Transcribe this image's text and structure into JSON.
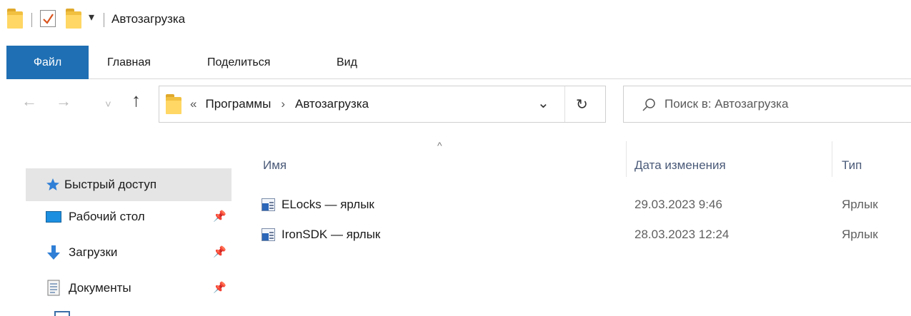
{
  "window": {
    "title": "Автозагрузка"
  },
  "quick_access_toolbar": {
    "dropdown_glyph": "▾"
  },
  "ribbon": {
    "file_tab": "Файл",
    "tabs": [
      "Главная",
      "Поделиться",
      "Вид"
    ]
  },
  "nav": {
    "back_glyph": "←",
    "forward_glyph": "→",
    "recent_glyph": "˅",
    "up_glyph": "↑",
    "breadcrumb_prefix": "«",
    "breadcrumb": [
      "Программы",
      "Автозагрузка"
    ],
    "breadcrumb_sep": "›",
    "dropdown_glyph": "⌄",
    "refresh_glyph": "↻"
  },
  "search": {
    "placeholder": "Поиск в: Автозагрузка"
  },
  "file_list": {
    "sort_glyph": "^",
    "columns": [
      "Имя",
      "Дата изменения",
      "Тип"
    ],
    "rows": [
      {
        "name": "ELocks — ярлык",
        "modified": "29.03.2023 9:46",
        "type": "Ярлык"
      },
      {
        "name": "IronSDK — ярлык",
        "modified": "28.03.2023 12:24",
        "type": "Ярлык"
      }
    ]
  },
  "sidebar": {
    "quick_access": "Быстрый доступ",
    "items": [
      {
        "label": "Рабочий стол",
        "icon": "desktop-icon"
      },
      {
        "label": "Загрузки",
        "icon": "downloads-icon"
      },
      {
        "label": "Документы",
        "icon": "documents-icon"
      }
    ]
  },
  "colors": {
    "accent": "#1f6fb4",
    "folder": "#ffd764",
    "selection": "#e5e5e5"
  }
}
